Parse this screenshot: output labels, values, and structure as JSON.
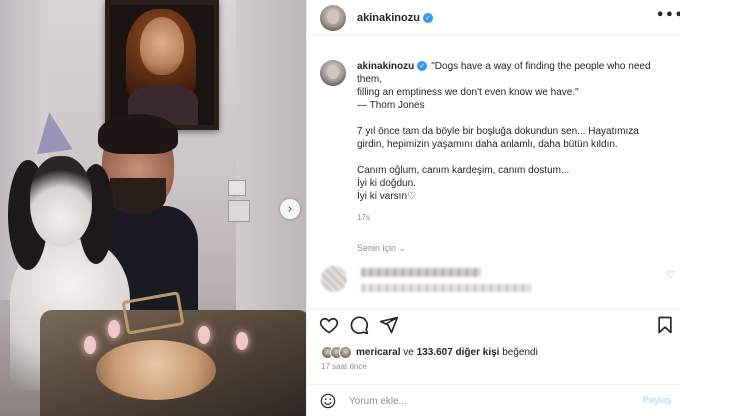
{
  "post": {
    "username": "akinakinozu",
    "more_label": "•••"
  },
  "caption": {
    "lines": [
      "\"Dogs have a way of finding the people who need",
      "them,",
      "filling an emptiness we don't even know we have.\"",
      "— Thom Jones",
      "",
      "7 yıl önce tam da böyle bir boşluğa dokundun sen... Hayatımıza",
      "girdin, hepimizin yaşamını daha anlamlı, daha bütün kıldın.",
      "",
      "Canım oğlum, canım kardeşim, canım dostum...",
      "İyi ki doğdun.",
      "İyi ki varsın♡"
    ],
    "time": "17s"
  },
  "for_you": "Senin için ⌄",
  "likes": {
    "user": "mericaral",
    "connector": "ve",
    "count_text": "133.607 diğer kişi",
    "suffix": "beğendi"
  },
  "posted_ago": "17 saat önce",
  "comment": {
    "placeholder": "Yorum ekle...",
    "post_label": "Paylaş"
  },
  "icons": {
    "like": "heart-icon",
    "comment": "comment-icon",
    "share": "send-icon",
    "save": "bookmark-icon",
    "emoji": "smile-icon",
    "next": "chevron-right-icon"
  },
  "colors": {
    "verified": "#3897f0",
    "muted": "#8e8e8e",
    "post_button": "#b2dffc"
  }
}
